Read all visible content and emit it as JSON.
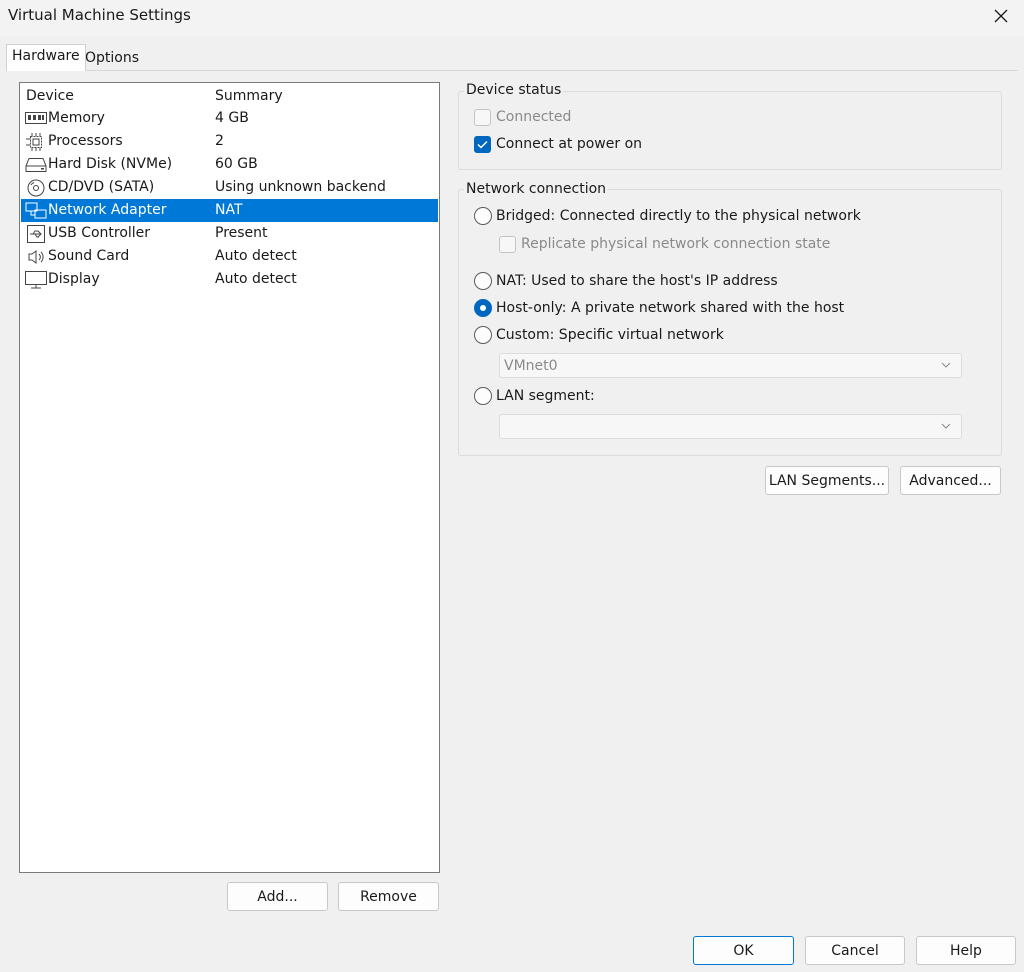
{
  "window": {
    "title": "Virtual Machine Settings"
  },
  "tabs": [
    {
      "label": "Hardware",
      "active": true
    },
    {
      "label": "Options",
      "active": false
    }
  ],
  "device_list": {
    "columns": [
      "Device",
      "Summary"
    ],
    "rows": [
      {
        "icon": "memory-icon",
        "device": "Memory",
        "summary": "4 GB"
      },
      {
        "icon": "processor-icon",
        "device": "Processors",
        "summary": "2"
      },
      {
        "icon": "hard-disk-icon",
        "device": "Hard Disk (NVMe)",
        "summary": "60 GB"
      },
      {
        "icon": "cd-dvd-icon",
        "device": "CD/DVD (SATA)",
        "summary": "Using unknown backend"
      },
      {
        "icon": "network-adapter-icon",
        "device": "Network Adapter",
        "summary": "NAT",
        "selected": true
      },
      {
        "icon": "usb-icon",
        "device": "USB Controller",
        "summary": "Present"
      },
      {
        "icon": "speaker-icon",
        "device": "Sound Card",
        "summary": "Auto detect"
      },
      {
        "icon": "monitor-icon",
        "device": "Display",
        "summary": "Auto detect"
      }
    ],
    "selection_color": "#0078d7"
  },
  "list_buttons": {
    "add": "Add...",
    "remove": "Remove"
  },
  "device_status": {
    "title": "Device status",
    "connected": {
      "label": "Connected",
      "checked": false,
      "enabled": false
    },
    "connect_at_power_on": {
      "label": "Connect at power on",
      "checked": true,
      "enabled": true
    }
  },
  "network_connection": {
    "title": "Network connection",
    "bridged": {
      "label": "Bridged: Connected directly to the physical network",
      "selected": false
    },
    "replicate": {
      "label": "Replicate physical network connection state",
      "checked": false,
      "enabled": false
    },
    "nat": {
      "label": "NAT: Used to share the host's IP address",
      "selected": false
    },
    "host_only": {
      "label": "Host-only: A private network shared with the host",
      "selected": true
    },
    "custom": {
      "label": "Custom: Specific virtual network",
      "selected": false
    },
    "custom_value": "VMnet0",
    "lan_segment": {
      "label": "LAN segment:",
      "selected": false
    },
    "lan_segment_value": ""
  },
  "network_buttons": {
    "lan_segments": "LAN Segments...",
    "advanced": "Advanced..."
  },
  "dialog_buttons": {
    "ok": "OK",
    "cancel": "Cancel",
    "help": "Help"
  },
  "colors": {
    "accent": "#0067c0",
    "background": "#f0f0f0"
  }
}
